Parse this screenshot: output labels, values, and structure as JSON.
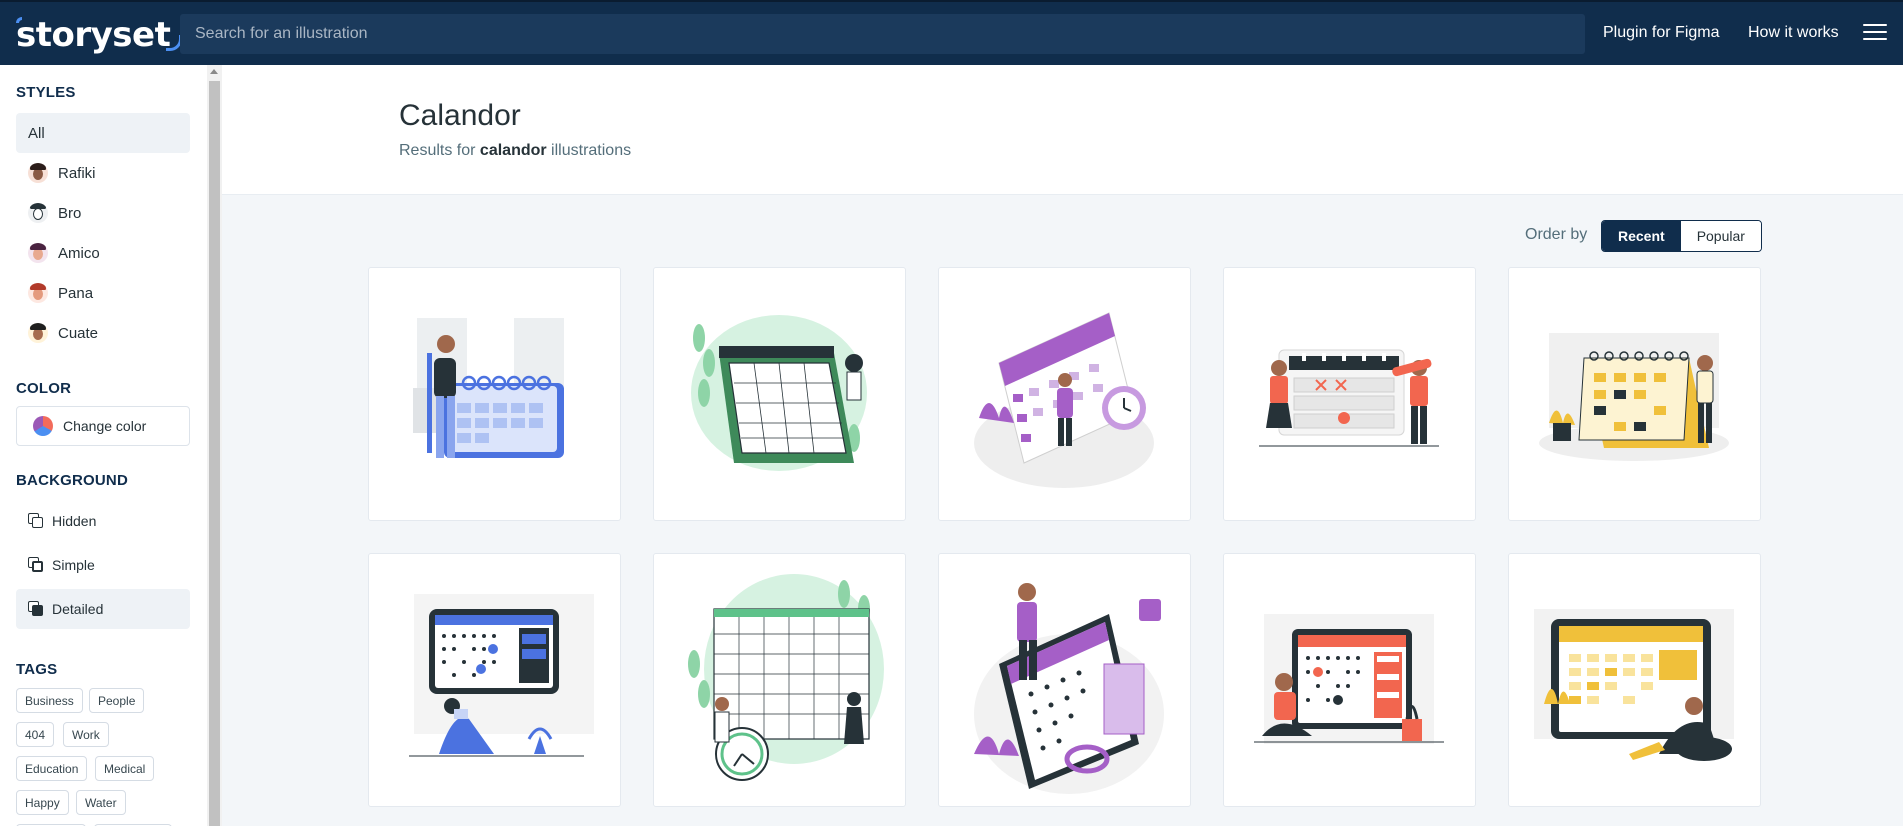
{
  "header": {
    "logo_text": "storyset",
    "search_placeholder": "Search for an illustration",
    "nav": [
      "Plugin for Figma",
      "How it works"
    ]
  },
  "sidebar": {
    "styles_title": "STYLES",
    "styles": [
      "All",
      "Rafiki",
      "Bro",
      "Amico",
      "Pana",
      "Cuate"
    ],
    "color_title": "COLOR",
    "color_button": "Change color",
    "background_title": "BACKGROUND",
    "backgrounds": [
      "Hidden",
      "Simple",
      "Detailed"
    ],
    "tags_title": "TAGS",
    "tags": [
      "Business",
      "People",
      "404",
      "Work",
      "Education",
      "Medical",
      "Happy",
      "Water"
    ]
  },
  "main": {
    "title": "Calandor",
    "subtitle_prefix": "Results for ",
    "subtitle_term": "calandor",
    "subtitle_suffix": " illustrations",
    "order_label": "Order by",
    "order_options": [
      "Recent",
      "Popular"
    ],
    "selected_order": "Recent"
  },
  "colors": {
    "header_bg": "#102d4c",
    "accent_blue": "#4b8ff2",
    "green": "#6fcf97",
    "purple": "#9b59b6",
    "red": "#f26b5b",
    "yellow": "#f2c94c"
  },
  "illustrations": [
    {
      "accent": "#4b72e0",
      "theme": "calendar-with-person-blue"
    },
    {
      "accent": "#5ec28a",
      "theme": "calendar-green-plants"
    },
    {
      "accent": "#a55fc7",
      "theme": "calendar-purple-clock"
    },
    {
      "accent": "#f2664f",
      "theme": "calendar-people-red"
    },
    {
      "accent": "#f0c03a",
      "theme": "calendar-yellow-woman"
    },
    {
      "accent": "#4b72e0",
      "theme": "tablet-calendar-blue"
    },
    {
      "accent": "#5ec28a",
      "theme": "wall-calendar-green-clock"
    },
    {
      "accent": "#a55fc7",
      "theme": "tablet-calendar-purple"
    },
    {
      "accent": "#f2664f",
      "theme": "tablet-calendar-red"
    },
    {
      "accent": "#f0c03a",
      "theme": "tablet-calendar-yellow"
    }
  ]
}
